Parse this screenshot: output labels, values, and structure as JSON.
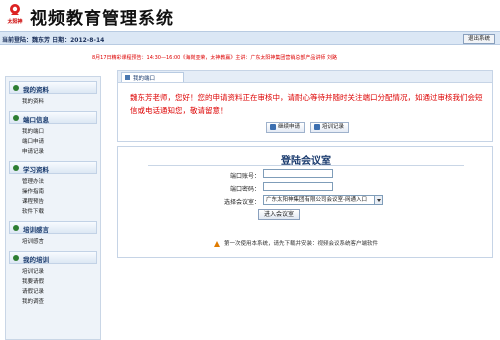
{
  "header": {
    "logo_text": "太阳神",
    "title": "视频教育管理系统"
  },
  "status_bar": {
    "login_info": "当前登陆：魏东芳 日期：2012-8-14",
    "logout_label": "退出系统"
  },
  "marquee": "8月17日精彩课程预告：14:30—16:00《海岗亚荣，太神教赢》主讲：广东太阳神集团营销总部产品讲师 刘路",
  "sidebar": {
    "sections": [
      {
        "title": "我的资料",
        "items": [
          "我的资料"
        ]
      },
      {
        "title": "端口信息",
        "items": [
          "我的端口",
          "端口申请",
          "申请记录"
        ]
      },
      {
        "title": "学习资料",
        "items": [
          "管理办法",
          "操作指南",
          "课程预告",
          "软件下载"
        ]
      },
      {
        "title": "培训感言",
        "items": [
          "培训感言"
        ]
      },
      {
        "title": "我的培训",
        "items": [
          "培训记录",
          "我要请假",
          "请假记录",
          "我的调查"
        ]
      }
    ]
  },
  "tab": {
    "label": "我的端口"
  },
  "notice": {
    "text": "魏东芳老师，您好！您的申请资料正在审核中，请耐心等待并随时关注端口分配情况，如通过审核我们会短信或电话通知您，敬请留意！",
    "buttons": [
      "继续申请",
      "培训记录"
    ]
  },
  "login_panel": {
    "title": "登陆会议室",
    "port_label": "端口账号：",
    "port_value": "",
    "password_label": "端口密码：",
    "password_value": "",
    "room_label": "选择会议室：",
    "room_selected": "广东太阳神集团有限公司会议室-网通入口",
    "enter_label": "进入会议室",
    "tip_text": "第一次使用本系统，请先下载并安装：",
    "tip_link": "视频会议系统客户端软件"
  },
  "colors": {
    "accent": "#1a3b6e",
    "notice_red": "#dd0000",
    "status_bar_bg": "#dbe7f5"
  }
}
